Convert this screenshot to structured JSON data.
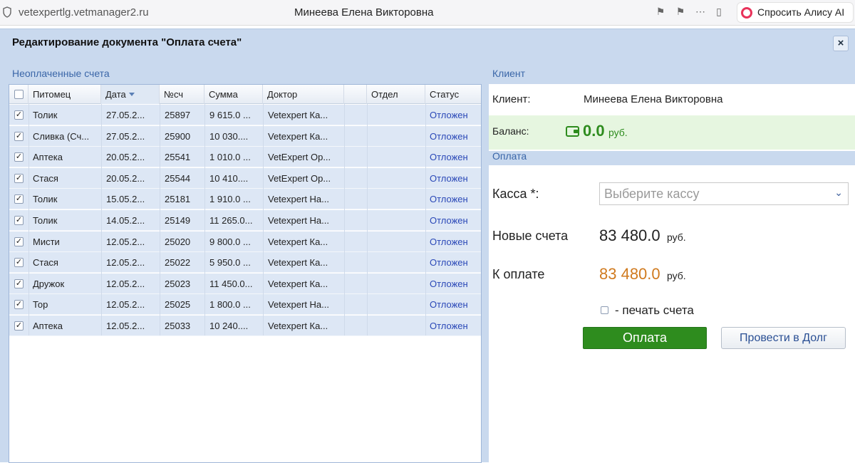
{
  "browser": {
    "url": "vetexpertlg.vetmanager2.ru",
    "tab_title": "Минеева Елена Викторовна",
    "alice_label": "Спросить Алису AI"
  },
  "dialog": {
    "title": "Редактирование документа \"Оплата счета\"",
    "close_label": "×"
  },
  "unpaid": {
    "section_title": "Неоплаченные счета",
    "columns": [
      "Питомец",
      "Дата",
      "№сч",
      "Сумма",
      "Доктор",
      "",
      "Отдел",
      "Статус"
    ],
    "rows": [
      {
        "pet": "Толик",
        "date": "27.05.2...",
        "num": "25897",
        "sum": "9 615.0 ...",
        "doctor": "Vetexpert Ка...",
        "status": "Отложен"
      },
      {
        "pet": "Сливка (Сч...",
        "date": "27.05.2...",
        "num": "25900",
        "sum": "10 030....",
        "doctor": "Vetexpert Ка...",
        "status": "Отложен"
      },
      {
        "pet": "Аптека",
        "date": "20.05.2...",
        "num": "25541",
        "sum": "1 010.0 ...",
        "doctor": "VetExpert Ор...",
        "status": "Отложен"
      },
      {
        "pet": "Стася",
        "date": "20.05.2...",
        "num": "25544",
        "sum": "10 410....",
        "doctor": "VetExpert Ор...",
        "status": "Отложен"
      },
      {
        "pet": "Толик",
        "date": "15.05.2...",
        "num": "25181",
        "sum": "1 910.0 ...",
        "doctor": "Vetexpert На...",
        "status": "Отложен"
      },
      {
        "pet": "Толик",
        "date": "14.05.2...",
        "num": "25149",
        "sum": "11 265.0...",
        "doctor": "Vetexpert На...",
        "status": "Отложен"
      },
      {
        "pet": "Мисти",
        "date": "12.05.2...",
        "num": "25020",
        "sum": "9 800.0 ...",
        "doctor": "Vetexpert Ка...",
        "status": "Отложен"
      },
      {
        "pet": "Стася",
        "date": "12.05.2...",
        "num": "25022",
        "sum": "5 950.0 ...",
        "doctor": "Vetexpert Ка...",
        "status": "Отложен"
      },
      {
        "pet": "Дружок",
        "date": "12.05.2...",
        "num": "25023",
        "sum": "11 450.0...",
        "doctor": "Vetexpert Ка...",
        "status": "Отложен"
      },
      {
        "pet": "Тор",
        "date": "12.05.2...",
        "num": "25025",
        "sum": "1 800.0 ...",
        "doctor": "Vetexpert На...",
        "status": "Отложен"
      },
      {
        "pet": "Аптека",
        "date": "12.05.2...",
        "num": "25033",
        "sum": "10 240....",
        "doctor": "Vetexpert Ка...",
        "status": "Отложен"
      }
    ]
  },
  "client": {
    "section_title": "Клиент",
    "client_label": "Клиент:",
    "client_name": "Минеева Елена Викторовна",
    "balance_label": "Баланс:",
    "balance_value": "0.0",
    "balance_unit": "руб.",
    "balance_color": "#2e8c1e"
  },
  "payment": {
    "section_title": "Оплата",
    "cashbox_label": "Касса *:",
    "cashbox_placeholder": "Выберите кассу",
    "new_bills_label": "Новые счета",
    "new_bills_value": "83 480.0",
    "new_bills_unit": "руб.",
    "to_pay_label": "К оплате",
    "to_pay_value": "83 480.0",
    "to_pay_unit": "руб.",
    "to_pay_color": "#d07a1e",
    "print_label": "- печать счета",
    "pay_button": "Оплата",
    "debt_button": "Провести в Долг"
  }
}
